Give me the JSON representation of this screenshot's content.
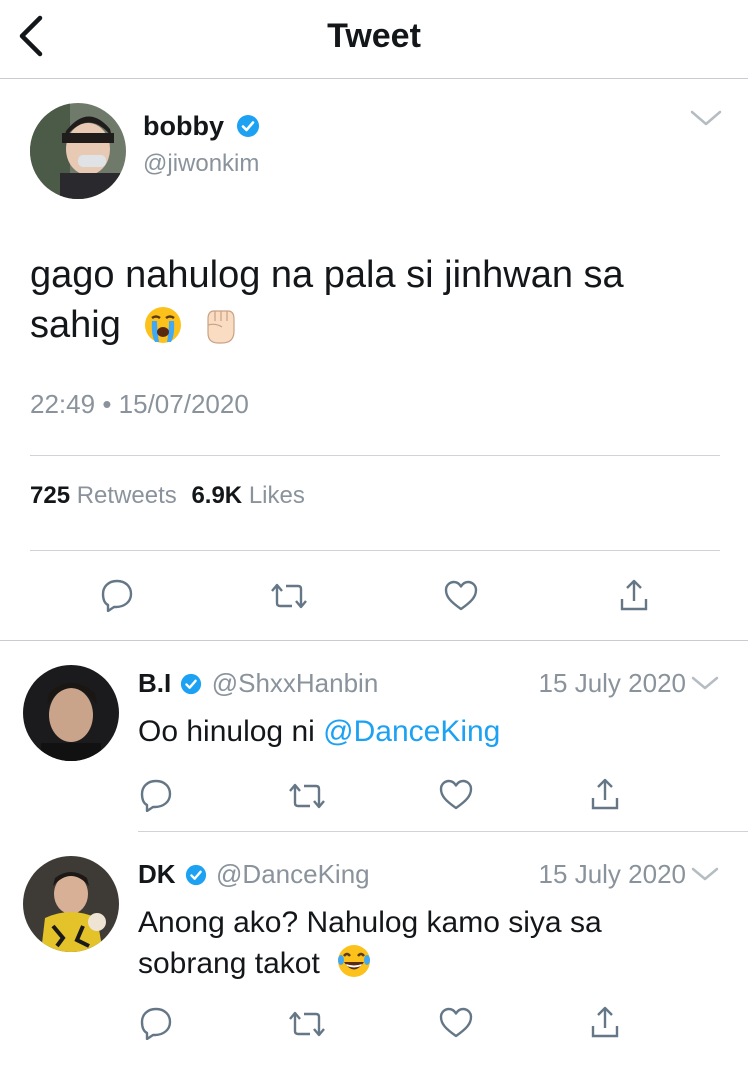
{
  "header": {
    "title": "Tweet"
  },
  "main_tweet": {
    "display_name": "bobby",
    "handle": "@jiwonkim",
    "text": "gago nahulog na pala si jinhwan sa",
    "text_line2": "sahig",
    "emojis": [
      "loudly-crying-face",
      "raised-fist"
    ],
    "time": "22:49",
    "separator": "•",
    "date": "15/07/2020",
    "retweets_count": "725",
    "retweets_label": "Retweets",
    "likes_count": "6.9K",
    "likes_label": "Likes"
  },
  "replies": [
    {
      "display_name": "B.I",
      "handle": "@ShxxHanbin",
      "date": "15 July 2020",
      "text_prefix": "Oo hinulog ni ",
      "mention": "@DanceKing"
    },
    {
      "display_name": "DK",
      "handle": "@DanceKing",
      "date": "15 July 2020",
      "text_line1": "Anong ako? Nahulog kamo siya sa",
      "text_line2": "sobrang takot",
      "emoji": "face-with-tears-of-joy"
    }
  ],
  "colors": {
    "accent": "#1da1f2",
    "muted": "#8a939c",
    "text": "#14171a",
    "icon": "#657786"
  }
}
